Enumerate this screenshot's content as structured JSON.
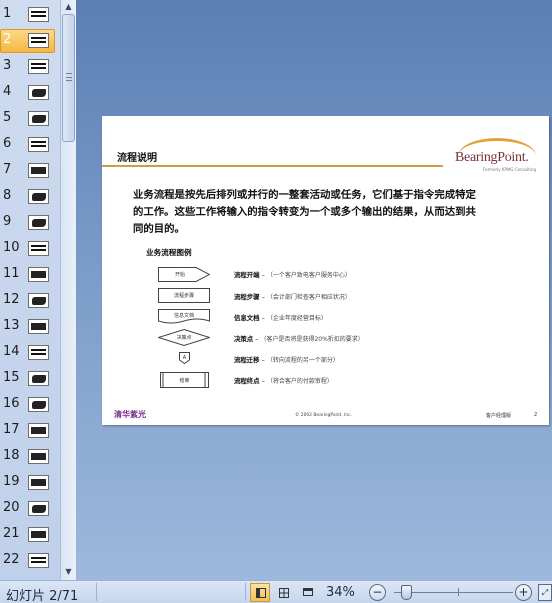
{
  "thumbnails": [
    {
      "num": "1",
      "style": "lines"
    },
    {
      "num": "2",
      "style": "lines",
      "selected": true
    },
    {
      "num": "3",
      "style": "lines"
    },
    {
      "num": "4",
      "style": "blob"
    },
    {
      "num": "5",
      "style": "blob"
    },
    {
      "num": "6",
      "style": "lines"
    },
    {
      "num": "7",
      "style": "block"
    },
    {
      "num": "8",
      "style": "blob"
    },
    {
      "num": "9",
      "style": "blob"
    },
    {
      "num": "10",
      "style": "lines"
    },
    {
      "num": "11",
      "style": "block"
    },
    {
      "num": "12",
      "style": "blob"
    },
    {
      "num": "13",
      "style": "block"
    },
    {
      "num": "14",
      "style": "lines"
    },
    {
      "num": "15",
      "style": "blob"
    },
    {
      "num": "16",
      "style": "blob"
    },
    {
      "num": "17",
      "style": "block"
    },
    {
      "num": "18",
      "style": "block"
    },
    {
      "num": "19",
      "style": "block"
    },
    {
      "num": "20",
      "style": "blob"
    },
    {
      "num": "21",
      "style": "block"
    },
    {
      "num": "22",
      "style": "lines"
    }
  ],
  "slide": {
    "title": "流程说明",
    "logo_text": "BearingPoint.",
    "logo_sub": "Formerly KPMG Consulting",
    "body": "业务流程是按先后排列或并行的一整套活动或任务，它们基于指令完成特定的工作。这些工作将输入的指令转变为一个或多个输出的结果，从而达到共同的目的。",
    "flow_heading": "业务流程图例",
    "legend": [
      {
        "shape": "start",
        "shape_label": "开始",
        "name": "流程开端",
        "desc": "（一个客户致电客户服务中心）"
      },
      {
        "shape": "rect",
        "shape_label": "流程步骤",
        "name": "流程步骤",
        "desc": "（会计部门检查客户相应状况）"
      },
      {
        "shape": "doc",
        "shape_label": "信息文档",
        "name": "信息文档",
        "desc": "（企业年度经营目标）"
      },
      {
        "shape": "diamond",
        "shape_label": "决策点",
        "name": "决策点",
        "desc": "（客户是否将是获得20%折扣的要求）"
      },
      {
        "shape": "connector",
        "shape_label": "A",
        "name": "流程迁移",
        "desc": "（转向流程的另一个部分）"
      },
      {
        "shape": "end",
        "shape_label": "结束",
        "name": "流程终点",
        "desc": "（将合客户的付款审程）"
      }
    ],
    "footer_logo": "清华紫光",
    "footer_copy": "© 2002 BearingPoint, Inc.",
    "footer_right": "客户经理版",
    "page_num": "2"
  },
  "status": {
    "slide_indicator": "幻灯片 2/71",
    "zoom": "34%",
    "zoom_out": "−",
    "zoom_in": "+",
    "zoom_fraction": 0.34
  }
}
